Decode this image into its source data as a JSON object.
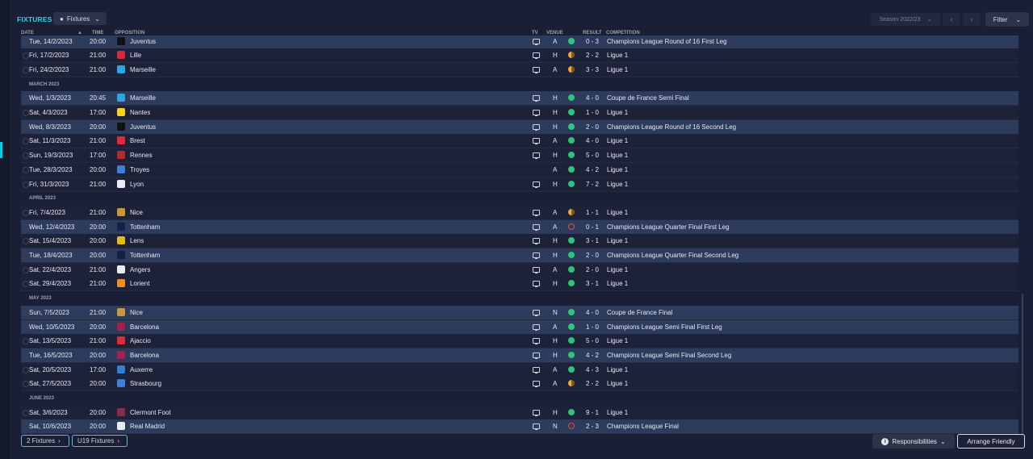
{
  "header": {
    "title": "FIXTURES",
    "view_label": "Fixtures",
    "season_label": "Season 2022/23",
    "filter_label": "Filter"
  },
  "columns": {
    "date": "DATE",
    "time": "TIME",
    "opposition": "OPPOSITION",
    "tv": "TV",
    "venue": "VENUE",
    "result": "RESULT",
    "competition": "COMPETITION"
  },
  "rows": [
    {
      "kind": "fixture",
      "date": "Tue, 14/2/2023",
      "time": "20:00",
      "opposition": "Juventus",
      "crest_color": "#111111",
      "tv": true,
      "venue": "A",
      "result": "W",
      "score": "0 - 3",
      "competition": "Champions League Round of 16 First Leg",
      "highlight": true
    },
    {
      "kind": "fixture",
      "date": "Fri, 17/2/2023",
      "time": "21:00",
      "opposition": "Lille",
      "crest_color": "#d32b3a",
      "tv": true,
      "venue": "H",
      "result": "D",
      "score": "2 - 2",
      "competition": "Ligue 1",
      "highlight": false
    },
    {
      "kind": "fixture",
      "date": "Fri, 24/2/2023",
      "time": "21:00",
      "opposition": "Marseille",
      "crest_color": "#2aa5e0",
      "tv": true,
      "venue": "A",
      "result": "D",
      "score": "3 - 3",
      "competition": "Ligue 1",
      "highlight": false
    },
    {
      "kind": "month",
      "label": "MARCH 2023"
    },
    {
      "kind": "fixture",
      "date": "Wed, 1/3/2023",
      "time": "20:45",
      "opposition": "Marseille",
      "crest_color": "#2aa5e0",
      "tv": true,
      "venue": "H",
      "result": "W",
      "score": "4 - 0",
      "competition": "Coupe de France Semi Final",
      "highlight": true
    },
    {
      "kind": "fixture",
      "date": "Sat, 4/3/2023",
      "time": "17:00",
      "opposition": "Nantes",
      "crest_color": "#f4d31c",
      "tv": true,
      "venue": "H",
      "result": "W",
      "score": "1 - 0",
      "competition": "Ligue 1",
      "highlight": false
    },
    {
      "kind": "fixture",
      "date": "Wed, 8/3/2023",
      "time": "20:00",
      "opposition": "Juventus",
      "crest_color": "#111111",
      "tv": true,
      "venue": "H",
      "result": "W",
      "score": "2 - 0",
      "competition": "Champions League Round of 16 Second Leg",
      "highlight": true
    },
    {
      "kind": "fixture",
      "date": "Sat, 11/3/2023",
      "time": "21:00",
      "opposition": "Brest",
      "crest_color": "#e0283a",
      "tv": true,
      "venue": "A",
      "result": "W",
      "score": "4 - 0",
      "competition": "Ligue 1",
      "highlight": false
    },
    {
      "kind": "fixture",
      "date": "Sun, 19/3/2023",
      "time": "17:00",
      "opposition": "Rennes",
      "crest_color": "#b52b2b",
      "tv": true,
      "venue": "H",
      "result": "W",
      "score": "5 - 0",
      "competition": "Ligue 1",
      "highlight": false
    },
    {
      "kind": "fixture",
      "date": "Tue, 28/3/2023",
      "time": "20:00",
      "opposition": "Troyes",
      "crest_color": "#3c7fd6",
      "tv": false,
      "venue": "A",
      "result": "W",
      "score": "4 - 2",
      "competition": "Ligue 1",
      "highlight": false
    },
    {
      "kind": "fixture",
      "date": "Fri, 31/3/2023",
      "time": "21:00",
      "opposition": "Lyon",
      "crest_color": "#e9ecf3",
      "tv": true,
      "venue": "H",
      "result": "W",
      "score": "7 - 2",
      "competition": "Ligue 1",
      "highlight": false
    },
    {
      "kind": "month",
      "label": "APRIL 2023"
    },
    {
      "kind": "fixture",
      "date": "Fri, 7/4/2023",
      "time": "21:00",
      "opposition": "Nice",
      "crest_color": "#c8973a",
      "tv": true,
      "venue": "A",
      "result": "D",
      "score": "1 - 1",
      "competition": "Ligue 1",
      "highlight": false
    },
    {
      "kind": "fixture",
      "date": "Wed, 12/4/2023",
      "time": "20:00",
      "opposition": "Tottenham",
      "crest_color": "#13214a",
      "tv": true,
      "venue": "A",
      "result": "L",
      "score": "0 - 1",
      "competition": "Champions League Quarter Final First Leg",
      "highlight": true
    },
    {
      "kind": "fixture",
      "date": "Sat, 15/4/2023",
      "time": "20:00",
      "opposition": "Lens",
      "crest_color": "#e8b719",
      "tv": true,
      "venue": "H",
      "result": "W",
      "score": "3 - 1",
      "competition": "Ligue 1",
      "highlight": false
    },
    {
      "kind": "fixture",
      "date": "Tue, 18/4/2023",
      "time": "20:00",
      "opposition": "Tottenham",
      "crest_color": "#13214a",
      "tv": true,
      "venue": "H",
      "result": "W",
      "score": "2 - 0",
      "competition": "Champions League Quarter Final Second Leg",
      "highlight": true
    },
    {
      "kind": "fixture",
      "date": "Sat, 22/4/2023",
      "time": "21:00",
      "opposition": "Angers",
      "crest_color": "#e9ecf3",
      "tv": true,
      "venue": "A",
      "result": "W",
      "score": "2 - 0",
      "competition": "Ligue 1",
      "highlight": false
    },
    {
      "kind": "fixture",
      "date": "Sat, 29/4/2023",
      "time": "21:00",
      "opposition": "Lorient",
      "crest_color": "#f28c28",
      "tv": true,
      "venue": "H",
      "result": "W",
      "score": "3 - 1",
      "competition": "Ligue 1",
      "highlight": false
    },
    {
      "kind": "month",
      "label": "MAY 2023"
    },
    {
      "kind": "fixture",
      "date": "Sun, 7/5/2023",
      "time": "21:00",
      "opposition": "Nice",
      "crest_color": "#c8973a",
      "tv": true,
      "venue": "N",
      "result": "W",
      "score": "4 - 0",
      "competition": "Coupe de France Final",
      "highlight": true
    },
    {
      "kind": "fixture",
      "date": "Wed, 10/5/2023",
      "time": "20:00",
      "opposition": "Barcelona",
      "crest_color": "#a2214c",
      "tv": true,
      "venue": "A",
      "result": "W",
      "score": "1 - 0",
      "competition": "Champions League Semi Final First Leg",
      "highlight": true
    },
    {
      "kind": "fixture",
      "date": "Sat, 13/5/2023",
      "time": "21:00",
      "opposition": "Ajaccio",
      "crest_color": "#e0283a",
      "tv": true,
      "venue": "H",
      "result": "W",
      "score": "5 - 0",
      "competition": "Ligue 1",
      "highlight": false
    },
    {
      "kind": "fixture",
      "date": "Tue, 16/5/2023",
      "time": "20:00",
      "opposition": "Barcelona",
      "crest_color": "#a2214c",
      "tv": true,
      "venue": "H",
      "result": "W",
      "score": "4 - 2",
      "competition": "Champions League Semi Final Second Leg",
      "highlight": true
    },
    {
      "kind": "fixture",
      "date": "Sat, 20/5/2023",
      "time": "17:00",
      "opposition": "Auxerre",
      "crest_color": "#2f7fd8",
      "tv": true,
      "venue": "A",
      "result": "W",
      "score": "4 - 3",
      "competition": "Ligue 1",
      "highlight": false
    },
    {
      "kind": "fixture",
      "date": "Sat, 27/5/2023",
      "time": "20:00",
      "opposition": "Strasbourg",
      "crest_color": "#3c7fd6",
      "tv": true,
      "venue": "A",
      "result": "D",
      "score": "2 - 2",
      "competition": "Ligue 1",
      "highlight": false
    },
    {
      "kind": "month",
      "label": "JUNE 2023"
    },
    {
      "kind": "fixture",
      "date": "Sat, 3/6/2023",
      "time": "20:00",
      "opposition": "Clermont Foot",
      "crest_color": "#8a2d4a",
      "tv": true,
      "venue": "H",
      "result": "W",
      "score": "9 - 1",
      "competition": "Ligue 1",
      "highlight": false
    },
    {
      "kind": "fixture",
      "date": "Sat, 10/6/2023",
      "time": "20:00",
      "opposition": "Real Madrid",
      "crest_color": "#e9ecf3",
      "tv": true,
      "venue": "N",
      "result": "L",
      "score": "2 - 3",
      "competition": "Champions League Final",
      "highlight": true
    }
  ],
  "footer": {
    "tab_2_fixtures": "2 Fixtures",
    "tab_u19_fixtures": "U19 Fixtures",
    "responsibilities_label": "Responsibilities",
    "arrange_friendly_label": "Arrange Friendly"
  }
}
